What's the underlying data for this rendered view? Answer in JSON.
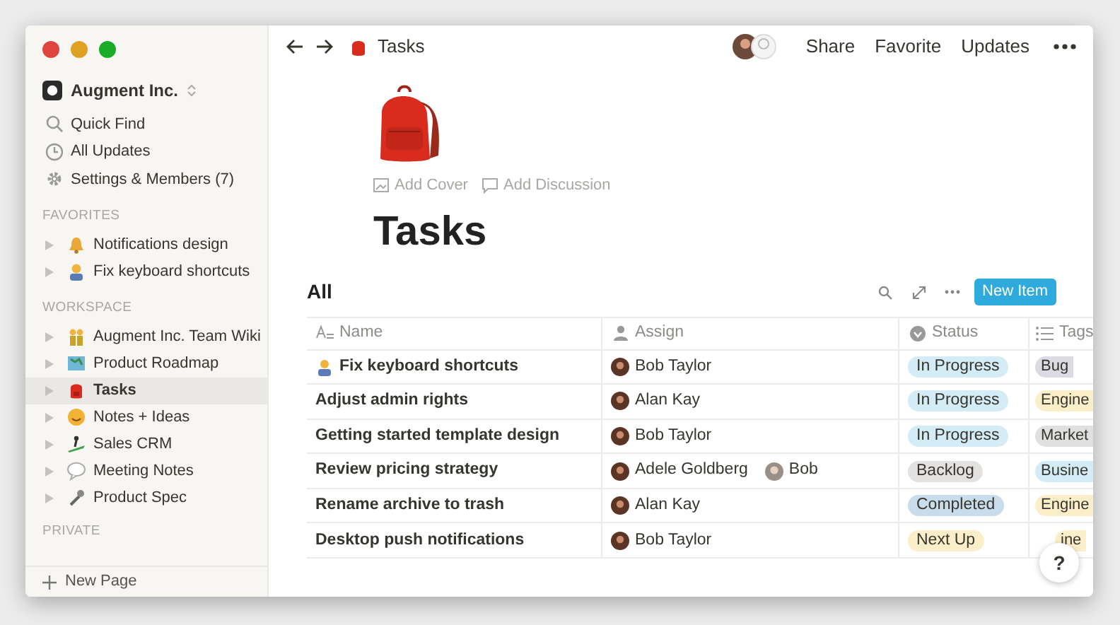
{
  "sidebar": {
    "workspace": "Augment Inc.",
    "actions": [
      {
        "label": "Quick Find"
      },
      {
        "label": "All Updates"
      },
      {
        "label": "Settings & Members (7)"
      }
    ],
    "sections": [
      {
        "title": "FAVORITES",
        "items": [
          {
            "label": "Notifications design",
            "selected": false
          },
          {
            "label": "Fix keyboard shortcuts",
            "selected": false
          }
        ]
      },
      {
        "title": "WORKSPACE",
        "items": [
          {
            "label": "Augment Inc. Team Wiki",
            "selected": false
          },
          {
            "label": "Product Roadmap",
            "selected": false
          },
          {
            "label": "Tasks",
            "selected": true
          },
          {
            "label": "Notes + Ideas",
            "selected": false
          },
          {
            "label": "Sales CRM",
            "selected": false
          },
          {
            "label": "Meeting Notes",
            "selected": false
          },
          {
            "label": "Product Spec",
            "selected": false
          }
        ]
      },
      {
        "title": "PRIVATE"
      }
    ],
    "new_page": "New Page"
  },
  "topbar": {
    "breadcrumb": "Tasks",
    "actions": [
      "Share",
      "Favorite",
      "Updates"
    ]
  },
  "page": {
    "add_cover": "Add Cover",
    "add_discussion": "Add Discussion",
    "title": "Tasks"
  },
  "view": {
    "title": "All",
    "new_button": "New Item"
  },
  "table": {
    "columns": [
      "Name",
      "Assign",
      "Status",
      "Tags"
    ],
    "rows": [
      {
        "name": "Fix keyboard shortcuts",
        "assign": [
          "Bob Taylor"
        ],
        "status": {
          "label": "In Progress",
          "color": "#d3ecf5"
        },
        "tag": {
          "label": "Bug",
          "color": "#dcdbe3"
        }
      },
      {
        "name": "Adjust admin rights",
        "assign": [
          "Alan Kay"
        ],
        "status": {
          "label": "In Progress",
          "color": "#d3ecf5"
        },
        "tag": {
          "label": "Engine",
          "color": "#fbefc9"
        }
      },
      {
        "name": "Getting started template design",
        "assign": [
          "Bob Taylor"
        ],
        "status": {
          "label": "In Progress",
          "color": "#d3ecf5"
        },
        "tag": {
          "label": "Market",
          "color": "#e0e0e0"
        }
      },
      {
        "name": "Review pricing strategy",
        "assign": [
          "Adele Goldberg",
          "Bob"
        ],
        "status": {
          "label": "Backlog",
          "color": "#e3e2e0"
        },
        "tag": {
          "label": "Busine",
          "color": "#d3ecf5"
        }
      },
      {
        "name": "Rename archive to trash",
        "assign": [
          "Alan Kay"
        ],
        "status": {
          "label": "Completed",
          "color": "#c9dcec"
        },
        "tag": {
          "label": "Engine",
          "color": "#fbefc9"
        }
      },
      {
        "name": "Desktop push notifications",
        "assign": [
          "Bob Taylor"
        ],
        "status": {
          "label": "Next Up",
          "color": "#fbefc9"
        },
        "tag": {
          "label": "ine",
          "color": "#fbefc9"
        }
      }
    ]
  },
  "help": "?"
}
